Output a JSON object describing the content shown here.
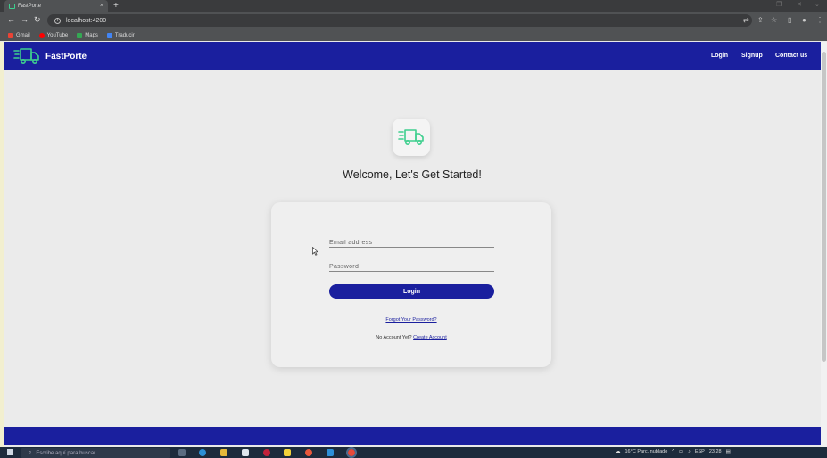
{
  "browser": {
    "tab_title": "FastPorte",
    "tab_close": "×",
    "new_tab": "+",
    "url": "localhost:4200",
    "bookmarks": [
      {
        "label": "Gmail",
        "color": "#ea4335"
      },
      {
        "label": "YouTube",
        "color": "#ff0000"
      },
      {
        "label": "Maps",
        "color": "#34a853"
      },
      {
        "label": "Traducir",
        "color": "#4285f4"
      }
    ]
  },
  "app": {
    "brand": "FastPorte",
    "nav": {
      "login": "Login",
      "signup": "Signup",
      "contact": "Contact us"
    },
    "welcome": "Welcome, Let's Get Started!",
    "email_placeholder": "Email address",
    "password_placeholder": "Password",
    "login_button": "Login",
    "forgot_link": "Forgot Your Password?",
    "no_account_text": "No Account Yet?",
    "create_account_link": "Create Account",
    "colors": {
      "primary": "#1a1f9e",
      "logo_green": "#3ecf8e"
    }
  },
  "taskbar": {
    "search_placeholder": "Escribe aquí para buscar",
    "weather": "16°C Parc. nublado",
    "language": "ESP",
    "time": "23:28"
  }
}
